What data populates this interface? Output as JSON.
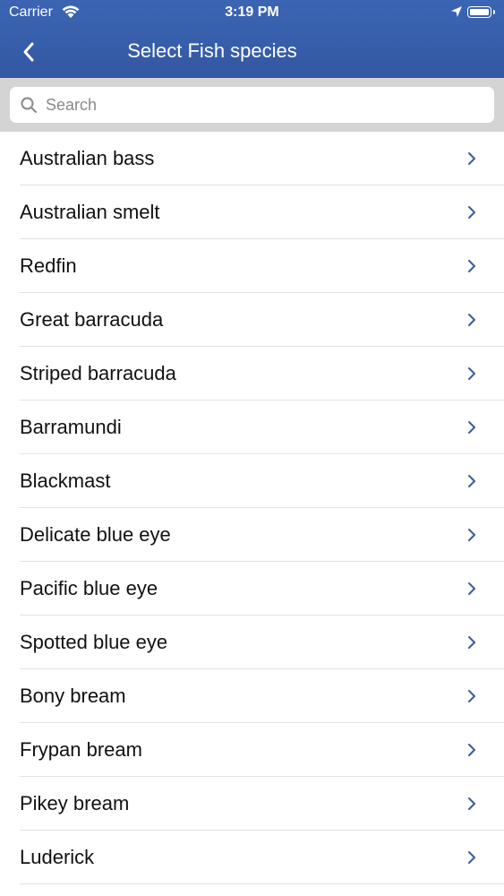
{
  "status_bar": {
    "carrier": "Carrier",
    "time": "3:19 PM"
  },
  "nav": {
    "title": "Select Fish species",
    "back_icon": "chevron-left-icon"
  },
  "search": {
    "placeholder": "Search",
    "value": ""
  },
  "species": [
    {
      "label": "Australian bass"
    },
    {
      "label": "Australian smelt"
    },
    {
      "label": "Redfin"
    },
    {
      "label": "Great barracuda"
    },
    {
      "label": "Striped barracuda"
    },
    {
      "label": "Barramundi"
    },
    {
      "label": "Blackmast"
    },
    {
      "label": "Delicate blue eye"
    },
    {
      "label": "Pacific blue eye"
    },
    {
      "label": "Spotted blue eye"
    },
    {
      "label": "Bony bream"
    },
    {
      "label": "Frypan bream"
    },
    {
      "label": "Pikey bream"
    },
    {
      "label": "Luderick"
    }
  ],
  "colors": {
    "nav_bar": "#3358a3",
    "chevron": "#3a5a9a"
  }
}
